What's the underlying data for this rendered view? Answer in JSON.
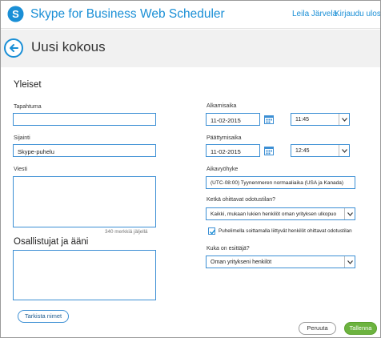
{
  "app": {
    "title": "Skype for Business Web Scheduler",
    "user_name": "Leila Järvelä",
    "sign_out": "Kirjaudu ulos"
  },
  "header": {
    "title": "Uusi kokous"
  },
  "general": {
    "section_title": "Yleiset",
    "event_label": "Tapahtuma",
    "event_value": "",
    "location_label": "Sijainti",
    "location_value": "Skype-puhelu",
    "message_label": "Viesti",
    "message_value": "",
    "chars_left": "340 merkkiä jäljellä"
  },
  "participants": {
    "section_title": "Osallistujat ja ääni",
    "value": "",
    "check_names": "Tarkista nimet"
  },
  "time": {
    "start_label": "Alkamisaika",
    "start_date": "11-02-2015",
    "start_time": "11:45",
    "end_label": "Päättymisaika",
    "end_date": "11-02-2015",
    "end_time": "12:45",
    "timezone_label": "Aikavyöhyke",
    "timezone_value": "(UTC-08:00) Tyynenmeren normaaliaika (USA ja Kanada)"
  },
  "lobby": {
    "bypass_label": "Ketkä ohittavat odotustilan?",
    "bypass_value": "Kaikki, mukaan lukien henkilöt oman yrityksen ulkopuo",
    "phone_bypass_label": "Puhelimella soittamalla liittyvät henkilöt ohittavat odotustilan",
    "phone_bypass_checked": true,
    "presenter_label": "Kuka on esittäjä?",
    "presenter_value": "Oman yritykseni henkilöt"
  },
  "actions": {
    "cancel": "Peruuta",
    "save": "Tallenna"
  },
  "colors": {
    "accent": "#1a8fd6",
    "save": "#6cb33f"
  }
}
